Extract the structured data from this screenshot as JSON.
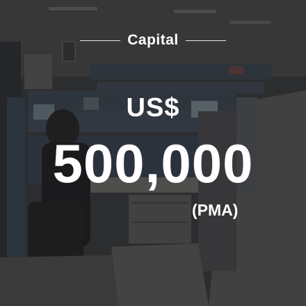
{
  "heading": {
    "label": "Capital"
  },
  "amount": {
    "currency": "US$",
    "value": "500,000",
    "note": "(PMA)"
  },
  "colors": {
    "text": "#ffffff",
    "overlay": "#141416"
  }
}
